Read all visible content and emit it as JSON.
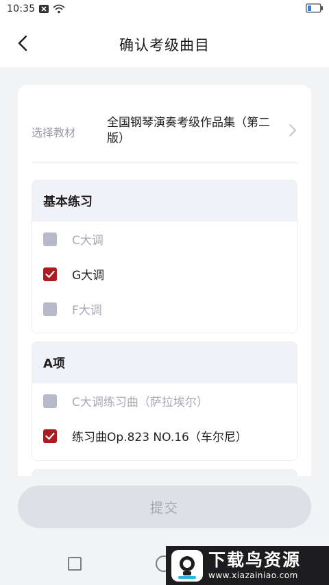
{
  "status_bar": {
    "time": "10:35",
    "icons": [
      "notification-x-icon",
      "wifi-icon",
      "battery-icon"
    ],
    "battery_color": "#2f7fe8"
  },
  "nav": {
    "back_icon": "chevron-left-icon",
    "title": "确认考级曲目"
  },
  "textbook": {
    "label": "选择教材",
    "value": "全国钢琴演奏考级作品集（第二版）",
    "chevron_icon": "chevron-right-icon"
  },
  "sections": [
    {
      "title": "基本练习",
      "items": [
        {
          "label": "C大调",
          "checked": false
        },
        {
          "label": "G大调",
          "checked": true
        },
        {
          "label": "F大调",
          "checked": false
        }
      ]
    },
    {
      "title": "A项",
      "items": [
        {
          "label": "C大调练习曲（萨拉埃尔）",
          "checked": false
        },
        {
          "label": "练习曲Op.823  NO.16（车尔尼）",
          "checked": true
        }
      ]
    }
  ],
  "submit_label": "提交",
  "colors": {
    "checked": "#a81d22",
    "unchecked": "#b6b9c7",
    "section_header_bg": "#f0f2f7",
    "page_bg": "#f2f3f5",
    "submit_bg": "#dfe0e6"
  },
  "watermark": {
    "brand": "下载鸟资源",
    "url": "www.xiazainiao.com"
  }
}
